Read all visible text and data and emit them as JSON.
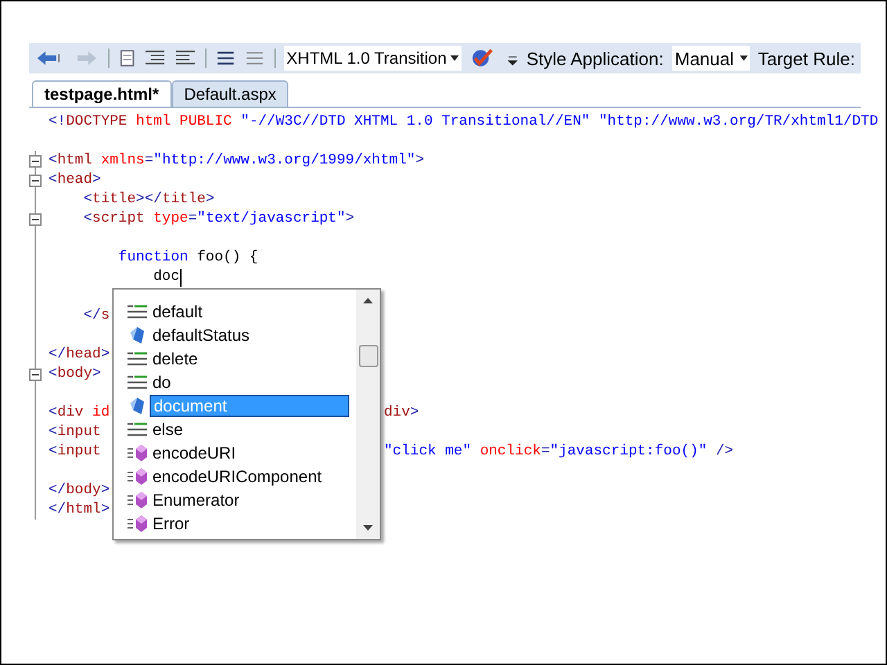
{
  "toolbar": {
    "doctype_dropdown": {
      "value": "XHTML 1.0 Transition"
    },
    "style_application": {
      "label": "Style Application:",
      "value": "Manual"
    },
    "target_rule": {
      "label": "Target Rule:"
    }
  },
  "tabs": [
    {
      "label": "testpage.html*",
      "selected": true
    },
    {
      "label": "Default.aspx",
      "selected": false
    }
  ],
  "editor": {
    "lines": [
      {
        "kind": "code",
        "left": [
          {
            "kind": "punct",
            "text": "<!"
          },
          {
            "kind": "tag",
            "text": "DOCTYPE"
          },
          {
            "kind": "attr",
            "text": " html PUBLIC "
          },
          {
            "kind": "value",
            "text": "\"-//W3C//DTD XHTML 1.0 Transitional//EN\" \"http://www.w3.org/TR/xhtml1/DTD"
          }
        ]
      },
      {
        "kind": "blank"
      },
      {
        "expanded": true,
        "left": [
          {
            "kind": "punct",
            "text": "<"
          },
          {
            "kind": "tag",
            "text": "html"
          },
          {
            "kind": "attr",
            "text": " xmlns"
          },
          {
            "kind": "punct",
            "text": "="
          },
          {
            "kind": "value",
            "text": "\"http://www.w3.org/1999/xhtml\""
          },
          {
            "kind": "punct",
            "text": ">"
          }
        ]
      },
      {
        "expanded": true,
        "left": [
          {
            "kind": "punct",
            "text": "<"
          },
          {
            "kind": "tag",
            "text": "head"
          },
          {
            "kind": "punct",
            "text": ">"
          }
        ]
      },
      {
        "left": [
          {
            "kind": "punct",
            "text": "    <"
          },
          {
            "kind": "tag",
            "text": "title"
          },
          {
            "kind": "punct",
            "text": "></"
          },
          {
            "kind": "tag",
            "text": "title"
          },
          {
            "kind": "punct",
            "text": ">"
          }
        ]
      },
      {
        "expanded": true,
        "left": [
          {
            "kind": "punct",
            "text": "    <"
          },
          {
            "kind": "tag",
            "text": "script"
          },
          {
            "kind": "attr",
            "text": " type"
          },
          {
            "kind": "punct",
            "text": "="
          },
          {
            "kind": "value",
            "text": "\"text/javascript\""
          },
          {
            "kind": "punct",
            "text": ">"
          }
        ]
      },
      {
        "kind": "blank"
      },
      {
        "left": [
          {
            "kind": "keyword",
            "text": "        function"
          },
          {
            "kind": "plain",
            "text": " foo() {"
          }
        ]
      },
      {
        "left": [
          {
            "kind": "plain",
            "text": "            doc"
          }
        ],
        "caret": true
      },
      {
        "kind": "blank"
      },
      {
        "left": [
          {
            "kind": "punct",
            "text": "    </"
          },
          {
            "kind": "tag",
            "text": "s"
          }
        ]
      },
      {
        "kind": "blank"
      },
      {
        "left": [
          {
            "kind": "punct",
            "text": "</"
          },
          {
            "kind": "tag",
            "text": "head"
          },
          {
            "kind": "punct",
            "text": ">"
          }
        ]
      },
      {
        "expanded": true,
        "left": [
          {
            "kind": "punct",
            "text": "<"
          },
          {
            "kind": "tag",
            "text": "body"
          },
          {
            "kind": "punct",
            "text": ">"
          }
        ]
      },
      {
        "kind": "blank"
      },
      {
        "left": [
          {
            "kind": "punct",
            "text": "<"
          },
          {
            "kind": "tag",
            "text": "div"
          },
          {
            "kind": "attr",
            "text": " id"
          }
        ],
        "right": [
          {
            "kind": "tag",
            "text": "div"
          },
          {
            "kind": "punct",
            "text": ">"
          }
        ]
      },
      {
        "left": [
          {
            "kind": "punct",
            "text": "<"
          },
          {
            "kind": "tag",
            "text": "input"
          }
        ]
      },
      {
        "left": [
          {
            "kind": "punct",
            "text": "<"
          },
          {
            "kind": "tag",
            "text": "input"
          }
        ],
        "right": [
          {
            "kind": "value",
            "text": "\"click me\""
          },
          {
            "kind": "attr",
            "text": " onclick"
          },
          {
            "kind": "punct",
            "text": "="
          },
          {
            "kind": "value",
            "text": "\"javascript:foo()\""
          },
          {
            "kind": "punct",
            "text": " />"
          }
        ]
      },
      {
        "kind": "blank"
      },
      {
        "left": [
          {
            "kind": "punct",
            "text": "</"
          },
          {
            "kind": "tag",
            "text": "body"
          },
          {
            "kind": "punct",
            "text": ">"
          }
        ]
      },
      {
        "left": [
          {
            "kind": "punct",
            "text": "</"
          },
          {
            "kind": "tag",
            "text": "html"
          },
          {
            "kind": "punct",
            "text": ">"
          }
        ]
      }
    ]
  },
  "completion_list": {
    "items": [
      {
        "label": "default",
        "kind": "keyword",
        "selected": false
      },
      {
        "label": "defaultStatus",
        "kind": "property",
        "selected": false
      },
      {
        "label": "delete",
        "kind": "keyword",
        "selected": false
      },
      {
        "label": "do",
        "kind": "keyword",
        "selected": false
      },
      {
        "label": "document",
        "kind": "property",
        "selected": true
      },
      {
        "label": "else",
        "kind": "keyword",
        "selected": false
      },
      {
        "label": "encodeURI",
        "kind": "method",
        "selected": false
      },
      {
        "label": "encodeURIComponent",
        "kind": "method",
        "selected": false
      },
      {
        "label": "Enumerator",
        "kind": "method",
        "selected": false
      },
      {
        "label": "Error",
        "kind": "method",
        "selected": false
      }
    ]
  }
}
